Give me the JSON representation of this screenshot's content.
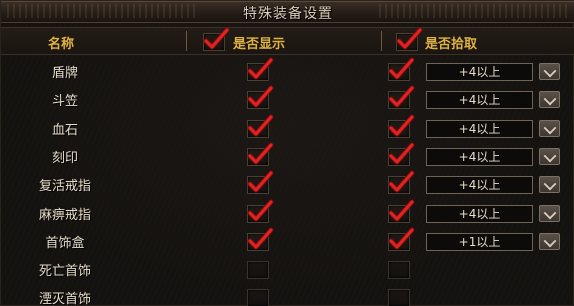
{
  "window": {
    "title": "特殊装备设置"
  },
  "header": {
    "name_label": "名称",
    "show_label": "是否显示",
    "show_checked": true,
    "pick_label": "是否拾取",
    "pick_checked": true
  },
  "rows": [
    {
      "name": "盾牌",
      "show": true,
      "pick": true,
      "level": "+4以上"
    },
    {
      "name": "斗笠",
      "show": true,
      "pick": true,
      "level": "+4以上"
    },
    {
      "name": "血石",
      "show": true,
      "pick": true,
      "level": "+4以上"
    },
    {
      "name": "刻印",
      "show": true,
      "pick": true,
      "level": "+4以上"
    },
    {
      "name": "复活戒指",
      "show": true,
      "pick": true,
      "level": "+4以上"
    },
    {
      "name": "麻痹戒指",
      "show": true,
      "pick": true,
      "level": "+4以上"
    },
    {
      "name": "首饰盒",
      "show": true,
      "pick": true,
      "level": "+1以上"
    },
    {
      "name": "死亡首饰",
      "show": false,
      "pick": false,
      "level": ""
    },
    {
      "name": "湮灭首饰",
      "show": false,
      "pick": false,
      "level": ""
    }
  ],
  "colors": {
    "header_text": "#e0b242",
    "check_red": "#d81f1f",
    "label_text": "#e6dcc8"
  }
}
